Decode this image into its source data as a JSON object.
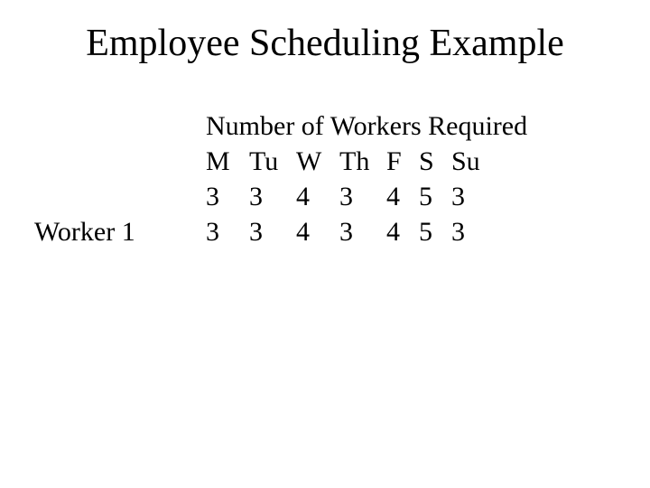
{
  "title": "Employee Scheduling Example",
  "header_line": "Number of Workers Required",
  "days": {
    "m": "M",
    "tu": "Tu",
    "w": "W",
    "th": "Th",
    "f": "F",
    "s": "S",
    "su": "Su"
  },
  "required": {
    "m": "3",
    "tu": "3",
    "w": "4",
    "th": "3",
    "f": "4",
    "s": "5",
    "su": "3"
  },
  "worker1_label": "Worker 1",
  "worker1": {
    "m": "3",
    "tu": "3",
    "w": "4",
    "th": "3",
    "f": "4",
    "s": "5",
    "su": "3"
  }
}
